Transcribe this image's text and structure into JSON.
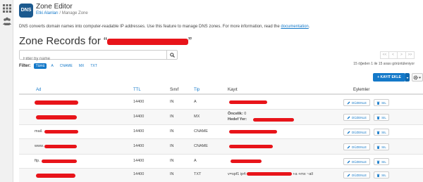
{
  "app": {
    "logo_text": "DNS",
    "title": "Zone Editor",
    "breadcrumb_home": "Etki Alanları",
    "breadcrumb_sep": "/",
    "breadcrumb_current": "Manage Zone"
  },
  "intro": {
    "text": "DNS converts domain names into computer-readable IP addresses. Use this feature to manage DNS zones. For more information, read the ",
    "link": "documentation",
    "suffix": "."
  },
  "heading": {
    "prefix": "Zone Records for “",
    "suffix": "”"
  },
  "search": {
    "placeholder": "Filter by name"
  },
  "filter": {
    "label": "Filter:",
    "options": [
      "Tümü",
      "A",
      "CNAME",
      "MX",
      "TXT"
    ],
    "active": "Tümü"
  },
  "pager": {
    "first": "<<",
    "prev": "<",
    "next": ">",
    "last": ">>",
    "info": "15 öğeden 1 ile 15 arası görüntüleniyor"
  },
  "toolbar": {
    "add_label": "+ KAYIT EKLE"
  },
  "columns": {
    "name": "Ad",
    "ttl": "TTL",
    "class": "Sınıf",
    "type": "Tip",
    "record": "Kayıt",
    "actions": "Eylemler"
  },
  "actions": {
    "edit": "DÜZENLE",
    "delete": "SIL"
  },
  "rows": [
    {
      "name": "",
      "ttl": "14400",
      "class": "IN",
      "type": "A",
      "record": ""
    },
    {
      "name": "",
      "ttl": "14400",
      "class": "IN",
      "type": "MX",
      "priority_label": "Öncelik:",
      "priority": "0",
      "target_label": "Hedef Yer:",
      "record": ""
    },
    {
      "name": "mail.",
      "ttl": "14400",
      "class": "IN",
      "type": "CNAME",
      "record": ""
    },
    {
      "name": "www.",
      "ttl": "14400",
      "class": "IN",
      "type": "CNAME",
      "record": ""
    },
    {
      "name": "ftp.",
      "ttl": "14400",
      "class": "IN",
      "type": "A",
      "record": ""
    },
    {
      "name": "",
      "ttl": "14400",
      "class": "IN",
      "type": "TXT",
      "record_prefix": "v=spf1 ip4:",
      "record_suffix": " +a +mx ~all"
    }
  ],
  "colors": {
    "accent": "#1479c9",
    "redaction": "#e8141a",
    "logo_bg": "#1c5a8f"
  }
}
